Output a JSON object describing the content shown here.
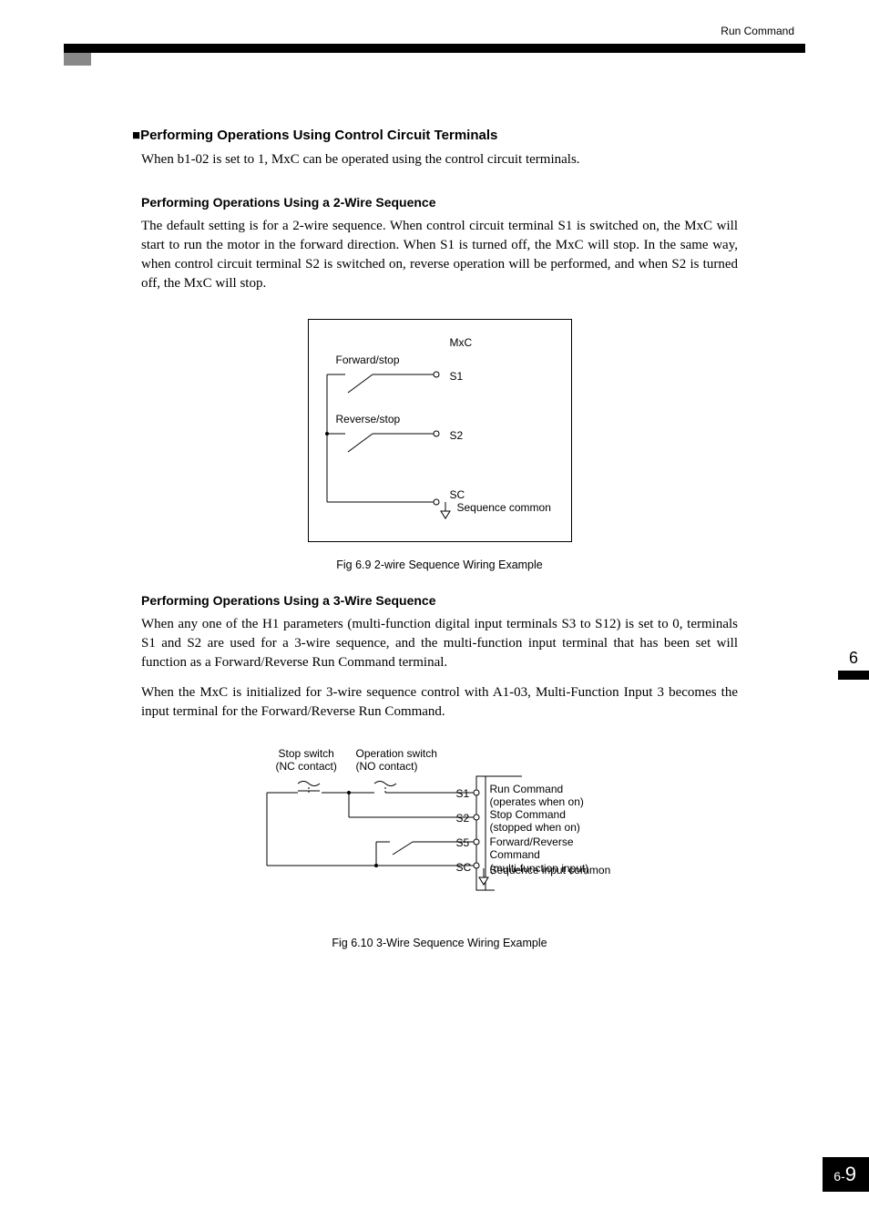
{
  "header": {
    "breadcrumb": "Run Command"
  },
  "section": {
    "title_bullet": "■",
    "title": "Performing Operations Using Control Circuit Terminals",
    "intro": "When b1-02 is set to 1, MxC can be operated using the control circuit terminals."
  },
  "two_wire": {
    "heading": "Performing Operations Using a 2-Wire Sequence",
    "body": "The default setting is for a 2-wire sequence. When control circuit terminal S1 is switched on, the MxC will start to run the motor in the forward direction. When S1 is turned off, the MxC will stop. In the same way, when control circuit terminal S2 is switched on, reverse operation will be performed, and when S2 is turned off, the MxC will stop.",
    "diagram": {
      "device": "MxC",
      "fwd_label": "Forward/stop",
      "rev_label": "Reverse/stop",
      "terminals": {
        "s1": "S1",
        "s2": "S2",
        "sc": "SC"
      },
      "sc_label": "Sequence common"
    },
    "caption": "Fig 6.9  2-wire Sequence Wiring Example"
  },
  "three_wire": {
    "heading": "Performing Operations Using a 3-Wire Sequence",
    "body1": "When any one of the H1 parameters (multi-function digital input terminals S3 to S12) is set to 0, terminals S1 and S2 are used for a 3-wire sequence, and the multi-function input terminal that has been set will function as a Forward/Reverse Run Command terminal.",
    "body2": "When the MxC is initialized for 3-wire sequence control with A1-03, Multi-Function Input 3 becomes the input terminal for the Forward/Reverse Run Command.",
    "diagram": {
      "stop_switch": {
        "line1": "Stop switch",
        "line2": "(NC contact)"
      },
      "operation_switch": {
        "line1": "Operation switch",
        "line2": "(NO contact)"
      },
      "terminals": {
        "s1": "S1",
        "s2": "S2",
        "s5": "S5",
        "sc": "SC"
      },
      "run": {
        "line1": "Run Command",
        "line2": "(operates when on)"
      },
      "stop": {
        "line1": "Stop Command",
        "line2": "(stopped when on)"
      },
      "fr": {
        "line1": "Forward/Reverse Command",
        "line2": "(multi-function input)"
      },
      "sic": "Sequence input common"
    },
    "caption": "Fig 6.10  3-Wire Sequence Wiring Example"
  },
  "side": {
    "chapter": "6",
    "page_prefix": "6-",
    "page_num": "9"
  }
}
